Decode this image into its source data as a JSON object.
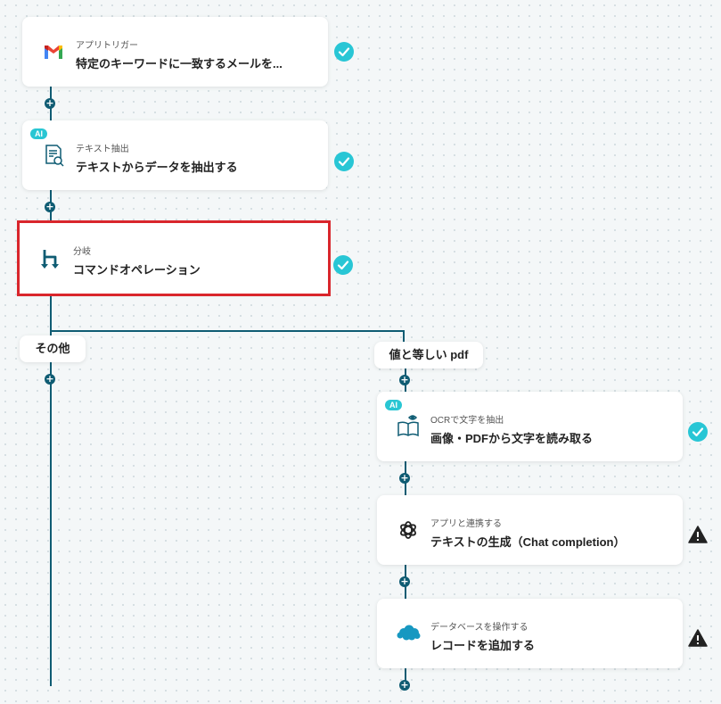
{
  "steps": [
    {
      "subtitle": "アプリトリガー",
      "title": "特定のキーワードに一致するメールを...",
      "icon": "gmail-icon",
      "ai": false,
      "status": "done"
    },
    {
      "subtitle": "テキスト抽出",
      "title": "テキストからデータを抽出する",
      "icon": "document-search-icon",
      "ai": true,
      "status": "done"
    },
    {
      "subtitle": "分岐",
      "title": "コマンドオペレーション",
      "icon": "branch-icon",
      "ai": false,
      "status": "done",
      "selected": true
    },
    {
      "subtitle": "OCRで文字を抽出",
      "title": "画像・PDFから文字を読み取る",
      "icon": "book-eye-icon",
      "ai": true,
      "status": "done"
    },
    {
      "subtitle": "アプリと連携する",
      "title": "テキストの生成（Chat completion）",
      "icon": "openai-icon",
      "ai": false,
      "status": "warning"
    },
    {
      "subtitle": "データベースを操作する",
      "title": "レコードを追加する",
      "icon": "salesforce-cloud-icon",
      "ai": false,
      "status": "warning"
    }
  ],
  "branches": {
    "left": "その他",
    "right": "値と等しい pdf"
  },
  "ai_badge": "AI",
  "colors": {
    "line": "#0f5c73",
    "check": "#28c6d5",
    "selected_outline": "#d9262c",
    "ai_badge": "#29c6d3"
  }
}
